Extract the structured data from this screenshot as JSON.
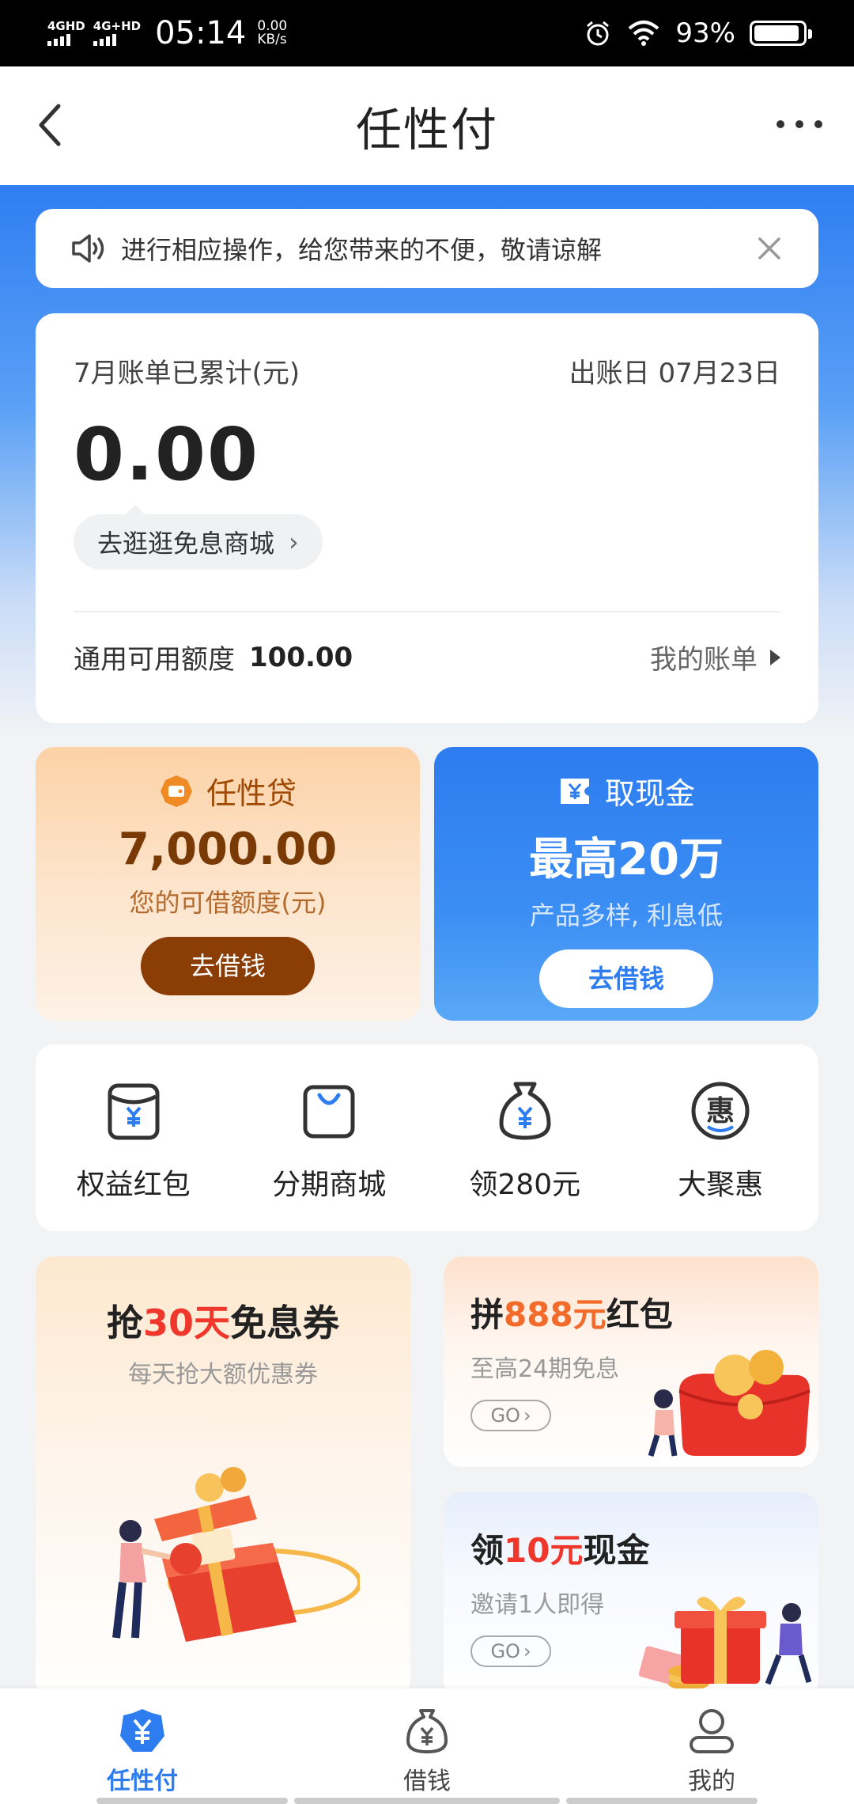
{
  "status_bar": {
    "sim1": "4GHD",
    "sim2": "4G+HD",
    "time": "05:14",
    "speed_value": "0.00",
    "speed_unit": "KB/s",
    "battery": "93%",
    "battery_level": 0.93
  },
  "header": {
    "title": "任性付"
  },
  "notice": {
    "text": "进行相应操作，给您带来的不便，敬请谅解"
  },
  "bill": {
    "label": "7月账单已累计(元)",
    "due_label": "出账日 07月23日",
    "amount": "0.00",
    "mall_link": "去逛逛免息商城",
    "credit_label": "通用可用额度",
    "credit_value": "100.00",
    "my_bill": "我的账单"
  },
  "loan_cards": [
    {
      "title": "任性贷",
      "value": "7,000.00",
      "subtitle": "您的可借额度(元)",
      "button": "去借钱"
    },
    {
      "title": "取现金",
      "value": "最高20万",
      "subtitle": "产品多样, 利息低",
      "button": "去借钱"
    }
  ],
  "quick_actions": [
    {
      "label": "权益红包",
      "icon": "red-packet-icon"
    },
    {
      "label": "分期商城",
      "icon": "shopping-bag-icon"
    },
    {
      "label": "领280元",
      "icon": "money-bag-icon"
    },
    {
      "label": "大聚惠",
      "icon": "hui-discount-icon"
    }
  ],
  "promos": {
    "big": {
      "pre": "抢",
      "highlight": "30天",
      "post": "免息券",
      "subtitle": "每天抢大额优惠券"
    },
    "small1": {
      "pre": "拼",
      "highlight": "888元",
      "post": "红包",
      "subtitle": "至高24期免息",
      "go": "GO"
    },
    "small2": {
      "pre": "领",
      "highlight": "10元",
      "post": "现金",
      "subtitle": "邀请1人即得",
      "go": "GO"
    }
  },
  "tabbar": [
    {
      "label": "任性付",
      "active": true
    },
    {
      "label": "借钱",
      "active": false
    },
    {
      "label": "我的",
      "active": false
    }
  ],
  "colors": {
    "brand_blue": "#2d7cf0",
    "loan_brown": "#8a3d05",
    "promo_red": "#f0372c"
  }
}
